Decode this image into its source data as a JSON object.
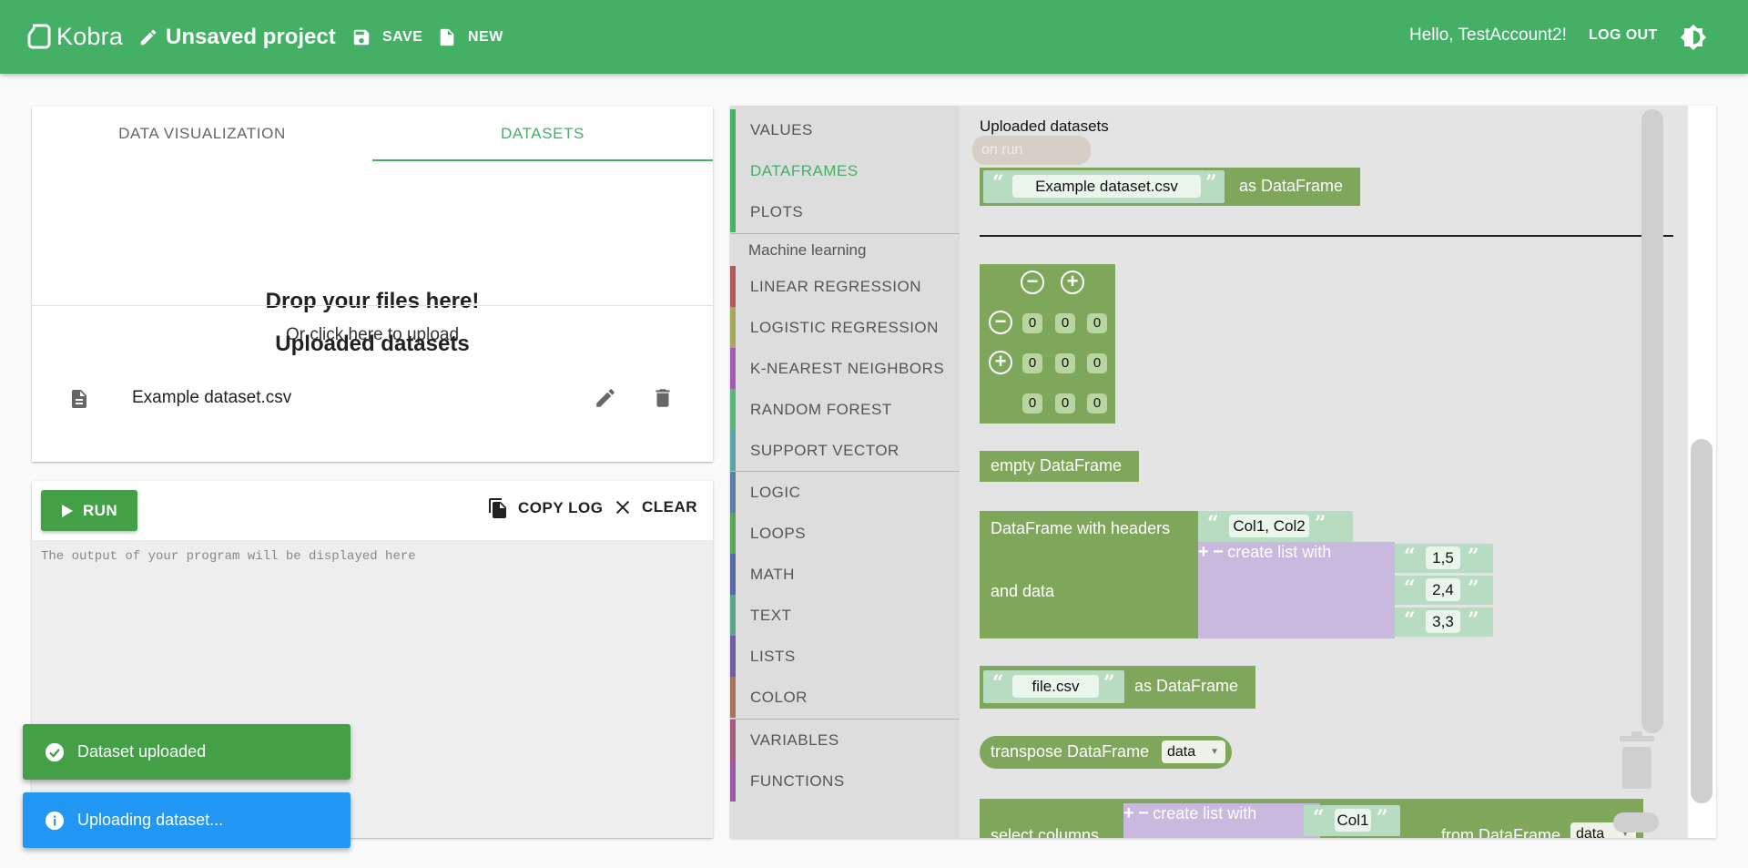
{
  "header": {
    "logo_text": "Kobra",
    "project_title": "Unsaved project",
    "save_label": "SAVE",
    "new_label": "NEW",
    "greeting": "Hello, TestAccount2!",
    "logout_label": "LOG OUT"
  },
  "tabs": [
    {
      "label": "DATA VISUALIZATION",
      "active": false
    },
    {
      "label": "DATASETS",
      "active": true
    }
  ],
  "dropzone": {
    "title": "Drop your files here!",
    "subtitle": "Or click here to upload"
  },
  "uploaded": {
    "title": "Uploaded datasets",
    "items": [
      {
        "name": "Example dataset.csv"
      }
    ]
  },
  "console": {
    "run_label": "RUN",
    "copy_label": "COPY LOG",
    "clear_label": "CLEAR",
    "placeholder": "The output of your program will be displayed here"
  },
  "toasts": [
    {
      "text": "Dataset uploaded",
      "type": "success"
    },
    {
      "text": "Uploading dataset...",
      "type": "info"
    }
  ],
  "toolbox": {
    "items": [
      {
        "label": "VALUES",
        "color": "#43b066"
      },
      {
        "label": "DATAFRAMES",
        "color": "#43b066",
        "selected": true
      },
      {
        "label": "PLOTS",
        "color": "#43b066"
      }
    ],
    "ml_category": "Machine learning",
    "ml_items": [
      {
        "label": "LINEAR REGRESSION",
        "color": "#b05a5a"
      },
      {
        "label": "LOGISTIC REGRESSION",
        "color": "#a8a85a"
      },
      {
        "label": "K-NEAREST NEIGHBORS",
        "color": "#a55ab5"
      },
      {
        "label": "RANDOM FOREST",
        "color": "#5ab57a"
      },
      {
        "label": "SUPPORT VECTOR",
        "color": "#5aa5a5"
      }
    ],
    "core_items": [
      {
        "label": "LOGIC",
        "color": "#5b80a5"
      },
      {
        "label": "LOOPS",
        "color": "#5ba55b"
      },
      {
        "label": "MATH",
        "color": "#5b67a5"
      },
      {
        "label": "TEXT",
        "color": "#5ba58c"
      },
      {
        "label": "LISTS",
        "color": "#745ba5"
      },
      {
        "label": "COLOR",
        "color": "#a5745b"
      }
    ],
    "var_items": [
      {
        "label": "VARIABLES",
        "color": "#a55b80"
      },
      {
        "label": "FUNCTIONS",
        "color": "#995ba5"
      }
    ]
  },
  "flyout": {
    "title": "Uploaded datasets",
    "ghost_label": "on run",
    "dataset_block": {
      "value": "Example dataset.csv",
      "suffix": "as DataFrame"
    },
    "matrix_values": [
      [
        "0",
        "0",
        "0"
      ],
      [
        "0",
        "0",
        "0"
      ],
      [
        "0",
        "0",
        "0"
      ]
    ],
    "empty_block": "empty DataFrame",
    "headers_block": {
      "label": "DataFrame with headers",
      "headers_value": "Col1, Col2",
      "data_label": "and data",
      "list_label": "create list with",
      "list_values": [
        "1,5",
        "2,4",
        "3,3"
      ]
    },
    "file_block": {
      "value": "file.csv",
      "suffix": "as DataFrame"
    },
    "transpose_block": {
      "label": "transpose DataFrame",
      "var": "data"
    },
    "select_block": {
      "label": "select columns",
      "list_label": "create list with",
      "list_value": "Col1",
      "from_label": "from DataFrame",
      "var": "data"
    }
  },
  "colors": {
    "primary": "#43b066",
    "block_green": "#7ea75b",
    "list_purple": "#c9b9de",
    "string_teal": "#b7dcc2",
    "toast_success": "#43a047",
    "toast_info": "#2196f3"
  }
}
